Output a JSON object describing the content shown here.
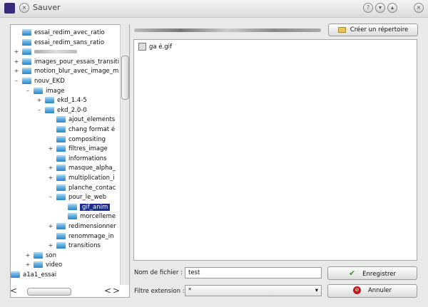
{
  "window": {
    "title": "Sauver"
  },
  "toolbar": {
    "create_dir_label": "Créer un répertoire"
  },
  "tree": {
    "items": [
      {
        "label": "essai_redim_avec_ratio",
        "indent": 0,
        "expander": ""
      },
      {
        "label": "essai_redim_sans_ratio",
        "indent": 0,
        "expander": ""
      },
      {
        "label": "",
        "indent": 0,
        "expander": "+",
        "blurred": true
      },
      {
        "label": "images_pour_essais_transiti",
        "indent": 0,
        "expander": "+"
      },
      {
        "label": "motion_blur_avec_image_m",
        "indent": 0,
        "expander": "+"
      },
      {
        "label": "nouv_EKD",
        "indent": 0,
        "expander": "–"
      },
      {
        "label": "image",
        "indent": 1,
        "expander": "–"
      },
      {
        "label": "ekd_1.4-5",
        "indent": 2,
        "expander": "+"
      },
      {
        "label": "ekd_2.0-0",
        "indent": 2,
        "expander": "–"
      },
      {
        "label": "ajout_elements",
        "indent": 3,
        "expander": ""
      },
      {
        "label": "chang format é",
        "indent": 3,
        "expander": ""
      },
      {
        "label": "compositing",
        "indent": 3,
        "expander": ""
      },
      {
        "label": "filtres_image",
        "indent": 3,
        "expander": "+"
      },
      {
        "label": "informations",
        "indent": 3,
        "expander": ""
      },
      {
        "label": "masque_alpha_",
        "indent": 3,
        "expander": "+"
      },
      {
        "label": "multiplication_i",
        "indent": 3,
        "expander": "+"
      },
      {
        "label": "planche_contac",
        "indent": 3,
        "expander": ""
      },
      {
        "label": "pour_le_web",
        "indent": 3,
        "expander": "–"
      },
      {
        "label": "gif_anim",
        "indent": 4,
        "expander": "",
        "selected": true
      },
      {
        "label": "morcelleme",
        "indent": 4,
        "expander": ""
      },
      {
        "label": "redimensionner",
        "indent": 3,
        "expander": "+"
      },
      {
        "label": "renommage_in",
        "indent": 3,
        "expander": ""
      },
      {
        "label": "transitions",
        "indent": 3,
        "expander": "+"
      },
      {
        "label": "son",
        "indent": 1,
        "expander": "+"
      },
      {
        "label": "video",
        "indent": 1,
        "expander": "+"
      },
      {
        "label": "a1a1_essai",
        "indent": -1,
        "expander": ""
      }
    ]
  },
  "files": [
    {
      "name": "ga é.gif"
    }
  ],
  "form": {
    "filename_label": "Nom de fichier :",
    "filename_value": "test",
    "filter_label": "Filtre extension :",
    "filter_value": "*",
    "save_label": "Enregistrer",
    "cancel_label": "Annuler"
  }
}
